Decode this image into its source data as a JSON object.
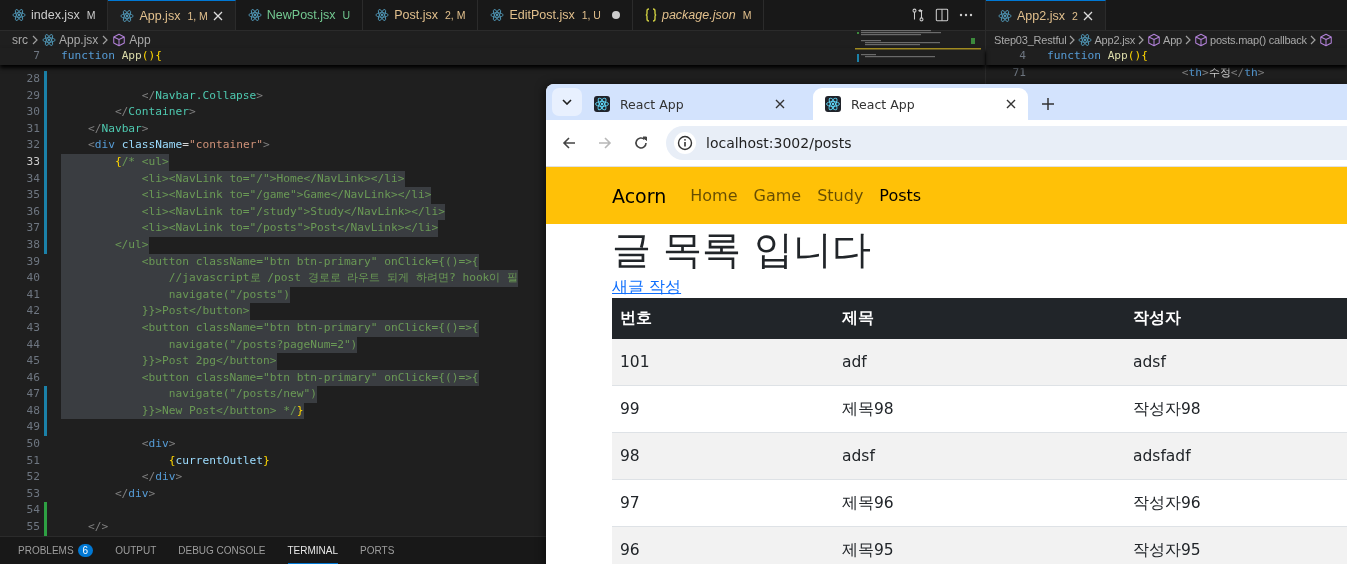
{
  "editor": {
    "tabs": [
      {
        "label": "index.jsx",
        "badge": "M",
        "color": "#cccccc",
        "kind": "react",
        "selected": false,
        "dirty": false,
        "preview": false
      },
      {
        "label": "App.jsx",
        "badge": "1, M",
        "color": "#e2c08d",
        "kind": "react",
        "selected": true,
        "dirty": false,
        "preview": false
      },
      {
        "label": "NewPost.jsx",
        "badge": "U",
        "color": "#73c991",
        "kind": "react",
        "selected": false,
        "dirty": false,
        "preview": false
      },
      {
        "label": "Post.jsx",
        "badge": "2, M",
        "color": "#e2c08d",
        "kind": "react",
        "selected": false,
        "dirty": false,
        "preview": false
      },
      {
        "label": "EditPost.jsx",
        "badge": "1, U",
        "color": "#e2c08d",
        "kind": "react",
        "selected": false,
        "dirty": true,
        "preview": false
      },
      {
        "label": "package.json",
        "badge": "M",
        "color": "#e2c08d",
        "kind": "json",
        "selected": false,
        "dirty": false,
        "preview": true
      }
    ],
    "breadcrumb": [
      {
        "label": "src"
      },
      {
        "label": "App.jsx",
        "kind": "react"
      },
      {
        "label": "App",
        "kind": "symbol"
      }
    ],
    "sticky_line": {
      "number": "7",
      "tokens": [
        {
          "kind": "keyword",
          "text": "function "
        },
        {
          "kind": "func",
          "text": "App"
        },
        {
          "kind": "brace",
          "text": "(){"
        }
      ]
    },
    "lines": [
      {
        "number": "28",
        "current": false,
        "color": "#1b81a8"
      },
      {
        "number": "29",
        "current": false,
        "color": "#1b81a8",
        "selected": false,
        "tokens": [
          {
            "kind": "punct",
            "text": "            </"
          },
          {
            "kind": "component",
            "text": "Navbar.Collapse"
          },
          {
            "kind": "punct",
            "text": ">"
          }
        ]
      },
      {
        "number": "30",
        "current": false,
        "color": "#1b81a8",
        "selected": false,
        "tokens": [
          {
            "kind": "punct",
            "text": "        </"
          },
          {
            "kind": "component",
            "text": "Container"
          },
          {
            "kind": "punct",
            "text": ">"
          }
        ]
      },
      {
        "number": "31",
        "current": false,
        "color": "#1b81a8",
        "selected": false,
        "tokens": [
          {
            "kind": "punct",
            "text": "    </"
          },
          {
            "kind": "component",
            "text": "Navbar"
          },
          {
            "kind": "punct",
            "text": ">"
          }
        ]
      },
      {
        "number": "32",
        "current": false,
        "color": "#1b81a8",
        "selected": false,
        "tokens": [
          {
            "kind": "punct",
            "text": "    <"
          },
          {
            "kind": "tag",
            "text": "div"
          },
          {
            "kind": "attr",
            "text": " className"
          },
          {
            "kind": "plain",
            "text": "="
          },
          {
            "kind": "string",
            "text": "\"container\""
          },
          {
            "kind": "punct",
            "text": ">"
          }
        ]
      },
      {
        "number": "33",
        "current": true,
        "color": "#1b81a8",
        "selected": true,
        "tokens": [
          {
            "kind": "brace",
            "text": "        {"
          },
          {
            "kind": "comment",
            "text": "/* <ul>"
          }
        ]
      },
      {
        "number": "34",
        "current": false,
        "color": "#1b81a8",
        "selected": true,
        "tokens": [
          {
            "kind": "comment",
            "text": "            <li><NavLink to=\"/\">Home</NavLink></li>"
          }
        ]
      },
      {
        "number": "35",
        "current": false,
        "color": "#1b81a8",
        "selected": true,
        "tokens": [
          {
            "kind": "comment",
            "text": "            <li><NavLink to=\"/game\">Game</NavLink></li>"
          }
        ]
      },
      {
        "number": "36",
        "current": false,
        "color": "#1b81a8",
        "selected": true,
        "tokens": [
          {
            "kind": "comment",
            "text": "            <li><NavLink to=\"/study\">Study</NavLink></li>"
          }
        ]
      },
      {
        "number": "37",
        "current": false,
        "color": "#1b81a8",
        "selected": true,
        "tokens": [
          {
            "kind": "comment",
            "text": "            <li><NavLink to=\"/posts\">Post</NavLink></li>"
          }
        ]
      },
      {
        "number": "38",
        "current": false,
        "color": "#1b81a8",
        "selected": true,
        "tokens": [
          {
            "kind": "comment",
            "text": "        </ul>"
          }
        ]
      },
      {
        "number": "39",
        "current": false,
        "selected": true,
        "tokens": [
          {
            "kind": "comment",
            "text": "            <button className=\"btn btn-primary\" onClick={()=>{"
          }
        ]
      },
      {
        "number": "40",
        "current": false,
        "selected": true,
        "tokens": [
          {
            "kind": "comment",
            "text": "                //javascript로 /post 경로로 라우트 되게 하려면? hook이 필"
          }
        ]
      },
      {
        "number": "41",
        "current": false,
        "selected": true,
        "tokens": [
          {
            "kind": "comment",
            "text": "                navigate(\"/posts\")"
          }
        ]
      },
      {
        "number": "42",
        "current": false,
        "selected": true,
        "tokens": [
          {
            "kind": "comment",
            "text": "            }}>Post</button>"
          }
        ]
      },
      {
        "number": "43",
        "current": false,
        "selected": true,
        "tokens": [
          {
            "kind": "comment",
            "text": "            <button className=\"btn btn-primary\" onClick={()=>{"
          }
        ]
      },
      {
        "number": "44",
        "current": false,
        "selected": true,
        "tokens": [
          {
            "kind": "comment",
            "text": "                navigate(\"/posts?pageNum=2\")"
          }
        ]
      },
      {
        "number": "45",
        "current": false,
        "selected": true,
        "tokens": [
          {
            "kind": "comment",
            "text": "            }}>Post 2pg</button>"
          }
        ]
      },
      {
        "number": "46",
        "current": false,
        "selected": true,
        "tokens": [
          {
            "kind": "comment",
            "text": "            <button className=\"btn btn-primary\" onClick={()=>{"
          }
        ]
      },
      {
        "number": "47",
        "current": false,
        "color": "#1b81a8",
        "selected": true,
        "tokens": [
          {
            "kind": "comment",
            "text": "                navigate(\"/posts/new\")"
          }
        ]
      },
      {
        "number": "48",
        "current": false,
        "color": "#1b81a8",
        "selected": true,
        "tokens": [
          {
            "kind": "comment",
            "text": "            }}>New Post</button> */"
          },
          {
            "kind": "brace",
            "text": "}"
          }
        ]
      },
      {
        "number": "49",
        "current": false,
        "color": "#1b81a8"
      },
      {
        "number": "50",
        "current": false,
        "selected": false,
        "tokens": [
          {
            "kind": "punct",
            "text": "            <"
          },
          {
            "kind": "tag",
            "text": "div"
          },
          {
            "kind": "punct",
            "text": ">"
          }
        ]
      },
      {
        "number": "51",
        "current": false,
        "selected": false,
        "tokens": [
          {
            "kind": "brace",
            "text": "                {"
          },
          {
            "kind": "var",
            "text": "currentOutlet"
          },
          {
            "kind": "brace",
            "text": "}"
          }
        ]
      },
      {
        "number": "52",
        "current": false,
        "selected": false,
        "tokens": [
          {
            "kind": "punct",
            "text": "            </"
          },
          {
            "kind": "tag",
            "text": "div"
          },
          {
            "kind": "punct",
            "text": ">"
          }
        ]
      },
      {
        "number": "53",
        "current": false,
        "selected": false,
        "tokens": [
          {
            "kind": "punct",
            "text": "        </"
          },
          {
            "kind": "tag",
            "text": "div"
          },
          {
            "kind": "punct",
            "text": ">"
          }
        ]
      },
      {
        "number": "54",
        "current": false,
        "color": "#2ea043"
      },
      {
        "number": "55",
        "current": false,
        "color": "#2ea043",
        "selected": false,
        "tokens": [
          {
            "kind": "punct",
            "text": "    </>"
          }
        ]
      }
    ]
  },
  "right_editor": {
    "tabs": [
      {
        "label": "App2.jsx",
        "badge": "2",
        "color": "#e2c08d",
        "kind": "react",
        "selected": true,
        "dirty": false,
        "preview": false
      }
    ],
    "breadcrumb": [
      {
        "label": "Step03_Restful"
      },
      {
        "label": "App2.jsx",
        "kind": "react"
      },
      {
        "label": "App",
        "kind": "symbol"
      },
      {
        "label": "posts.map() callback",
        "kind": "symbol"
      }
    ],
    "sticky_line": {
      "number": "4",
      "tokens": [
        {
          "kind": "keyword",
          "text": "function "
        },
        {
          "kind": "func",
          "text": "App"
        },
        {
          "kind": "brace",
          "text": "(){"
        }
      ]
    },
    "lines": [
      {
        "number": "71",
        "current": false,
        "selected": false,
        "tokens": [
          {
            "kind": "punct",
            "text": "                    <"
          },
          {
            "kind": "tag",
            "text": "th"
          },
          {
            "kind": "punct",
            "text": ">"
          },
          {
            "kind": "plain",
            "text": "수정"
          },
          {
            "kind": "punct",
            "text": "</"
          },
          {
            "kind": "tag",
            "text": "th"
          },
          {
            "kind": "punct",
            "text": ">"
          }
        ]
      }
    ]
  },
  "panel": {
    "tabs": [
      {
        "label": "PROBLEMS",
        "count": "6",
        "selected": false
      },
      {
        "label": "OUTPUT",
        "selected": false
      },
      {
        "label": "DEBUG CONSOLE",
        "selected": false
      },
      {
        "label": "TERMINAL",
        "selected": true
      },
      {
        "label": "PORTS",
        "selected": false
      }
    ]
  },
  "browser": {
    "tabs": [
      {
        "title": "React App",
        "selected": false
      },
      {
        "title": "React App",
        "selected": true
      }
    ],
    "url": "localhost:3002/posts",
    "forward_enabled": false,
    "page": {
      "brand": "Acorn",
      "nav": [
        {
          "label": "Home",
          "selected": false
        },
        {
          "label": "Game",
          "selected": false
        },
        {
          "label": "Study",
          "selected": false
        },
        {
          "label": "Posts",
          "selected": true
        }
      ],
      "heading": "글 목록 입니다",
      "link": "새글 작성",
      "table": {
        "columns": [
          "번호",
          "제목",
          "작성자"
        ],
        "rows": [
          [
            "101",
            "adf",
            "adsf"
          ],
          [
            "99",
            "제목98",
            "작성자98"
          ],
          [
            "98",
            "adsf",
            "adsfadf"
          ],
          [
            "97",
            "제목96",
            "작성자96"
          ],
          [
            "96",
            "제목95",
            "작성자95"
          ]
        ]
      }
    }
  }
}
